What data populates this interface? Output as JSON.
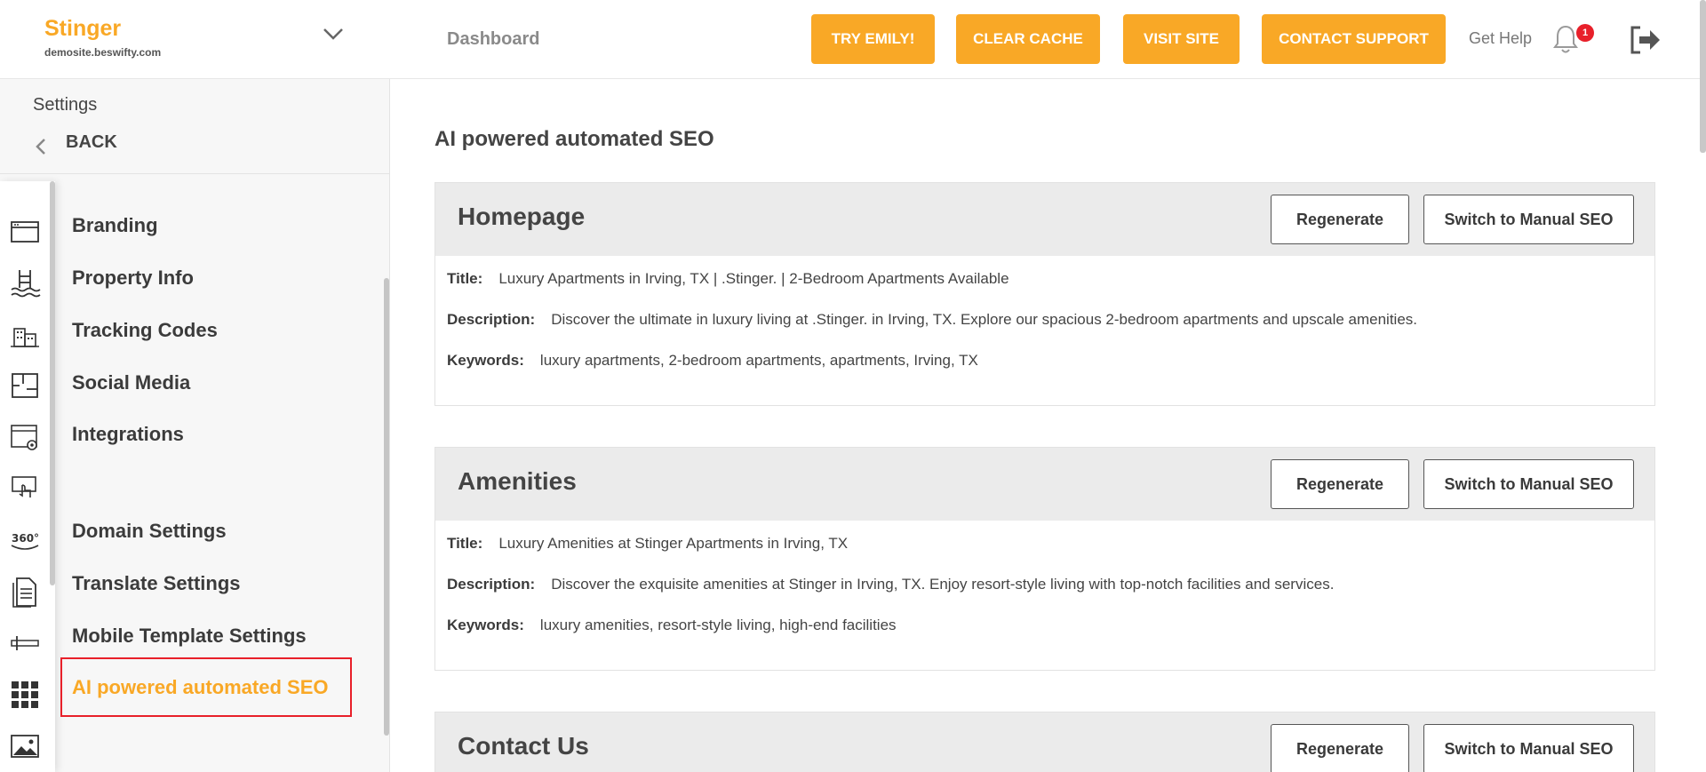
{
  "brand": {
    "name": "Stinger",
    "domain": "demosite.beswifty.com"
  },
  "settings": {
    "title": "Settings",
    "back_label": "BACK"
  },
  "icons": [
    "browser-window-icon",
    "pool-icon",
    "buildings-icon",
    "floorplan-icon",
    "web-settings-icon",
    "touch-screen-icon",
    "360-view-icon",
    "document-icon",
    "slider-icon",
    "grid-icon",
    "image-icon"
  ],
  "menu": {
    "branding": "Branding",
    "property_info": "Property Info",
    "tracking_codes": "Tracking Codes",
    "social_media": "Social Media",
    "integrations": "Integrations",
    "domain_settings": "Domain Settings",
    "translate_settings": "Translate Settings",
    "mobile_template_settings": "Mobile Template Settings",
    "ai_seo": "AI powered automated SEO"
  },
  "topbar": {
    "breadcrumb": "Dashboard",
    "try_emily": "TRY EMILY!",
    "clear_cache": "CLEAR CACHE",
    "visit_site": "VISIT SITE",
    "contact_support": "CONTACT SUPPORT",
    "get_help": "Get Help",
    "notification_count": "1"
  },
  "main": {
    "title": "AI powered automated SEO",
    "regenerate_label": "Regenerate",
    "switch_label": "Switch to Manual SEO",
    "labels": {
      "title": "Title:",
      "description": "Description:",
      "keywords": "Keywords:"
    },
    "cards": [
      {
        "name": "Homepage",
        "title": "Luxury Apartments in Irving, TX | .Stinger. | 2-Bedroom Apartments Available",
        "description": "Discover the ultimate in luxury living at .Stinger. in Irving, TX. Explore our spacious 2-bedroom apartments and upscale amenities.",
        "keywords": "luxury apartments, 2-bedroom apartments, apartments, Irving, TX"
      },
      {
        "name": "Amenities",
        "title": "Luxury Amenities at Stinger Apartments in Irving, TX",
        "description": "Discover the exquisite amenities at Stinger in Irving, TX. Enjoy resort-style living with top-notch facilities and services.",
        "keywords": "luxury amenities, resort-style living, high-end facilities"
      },
      {
        "name": "Contact Us"
      }
    ]
  },
  "colors": {
    "accent": "#f9a826",
    "highlight_border": "#e8202a",
    "card_header": "#ebebeb"
  }
}
